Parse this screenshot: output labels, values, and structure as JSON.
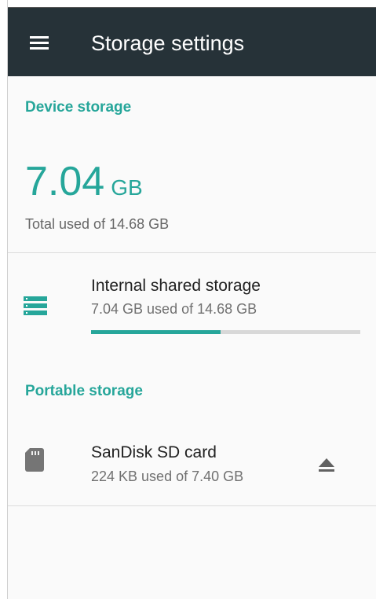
{
  "appbar": {
    "title": "Storage settings",
    "menu_icon": "hamburger-menu-icon"
  },
  "device_storage": {
    "header": "Device storage",
    "used_value": "7.04",
    "used_unit": "GB",
    "total_used_text": "Total used of 14.68 GB"
  },
  "internal_storage": {
    "icon": "storage-icon",
    "title": "Internal shared storage",
    "subtitle": "7.04 GB used of 14.68 GB",
    "used_fraction": 0.4796
  },
  "portable_storage": {
    "header": "Portable storage",
    "items": [
      {
        "icon": "sd-card-icon",
        "title": "SanDisk SD card",
        "subtitle": "224 KB used of 7.40 GB",
        "action_icon": "eject-icon"
      }
    ]
  },
  "colors": {
    "accent": "#26a69a",
    "appbar_bg": "#263238",
    "track": "#d8d8d8"
  }
}
